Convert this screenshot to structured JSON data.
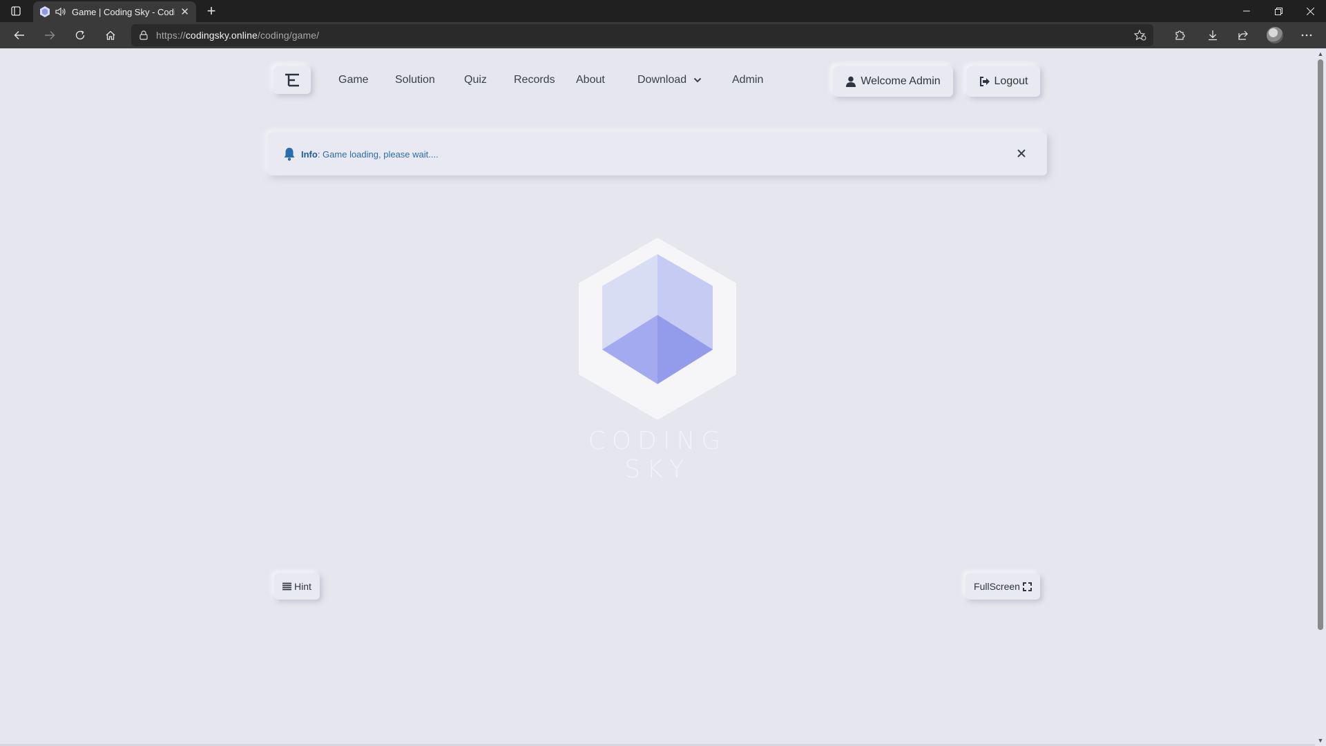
{
  "browser": {
    "tab": {
      "title": "Game | Coding Sky - Coding Sky"
    },
    "url": {
      "scheme": "https://",
      "host": "codingsky.online",
      "path": "/coding/game/"
    }
  },
  "navbar": {
    "links": [
      "Game",
      "Solution",
      "Quiz",
      "Records",
      "About",
      "Download",
      "Admin"
    ],
    "welcome_label": "Welcome Admin",
    "logout_label": "Logout"
  },
  "alert": {
    "label": "Info",
    "message": ": Game loading, please wait....",
    "color": "#2a6cb0"
  },
  "logo": {
    "text": "CODING SKY"
  },
  "controls": {
    "hint_label": "Hint",
    "fullscreen_label": "FullScreen"
  },
  "colors": {
    "background": "#e5e6ee",
    "accent": "#2a6cb0",
    "logo_cube": "#a3aaf0"
  }
}
